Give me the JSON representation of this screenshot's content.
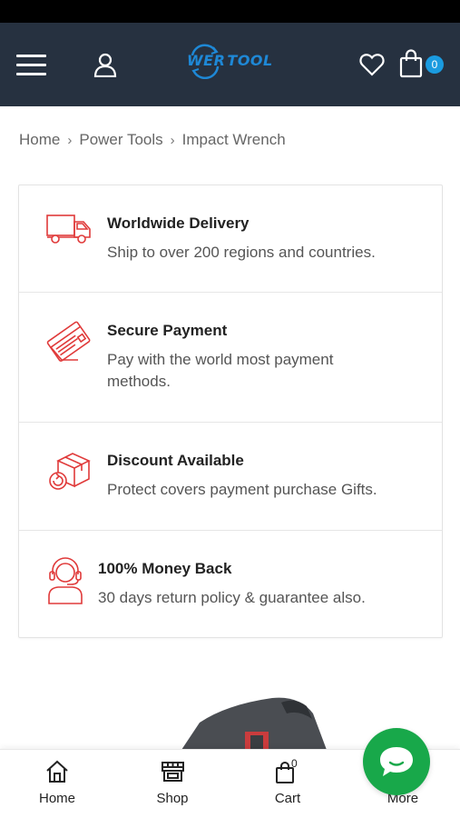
{
  "header": {
    "logo_text_left": "WER",
    "logo_text_right": "TOOL",
    "cart_badge": "0"
  },
  "breadcrumb": {
    "items": [
      "Home",
      "Power Tools",
      "Impact Wrench"
    ]
  },
  "features": [
    {
      "icon": "truck-icon",
      "title": "Worldwide Delivery",
      "description": "Ship to over 200 regions and countries."
    },
    {
      "icon": "credit-card-icon",
      "title": "Secure Payment",
      "description": "Pay with the world most payment methods."
    },
    {
      "icon": "box-return-icon",
      "title": "Discount Available",
      "description": "Protect covers payment purchase Gifts."
    },
    {
      "icon": "headset-icon",
      "title": "100% Money Back",
      "description": "30 days return policy & guarantee also."
    }
  ],
  "bottom_nav": {
    "items": [
      {
        "label": "Home",
        "icon": "home-icon"
      },
      {
        "label": "Shop",
        "icon": "store-icon"
      },
      {
        "label": "Cart",
        "icon": "cart-bag-icon"
      },
      {
        "label": "More",
        "icon": "more-icon"
      }
    ],
    "cart_count": "0"
  },
  "colors": {
    "header_bg": "#263140",
    "accent_red": "#e03a3a",
    "badge_blue": "#1a9be0",
    "chat_green": "#18a84a"
  }
}
